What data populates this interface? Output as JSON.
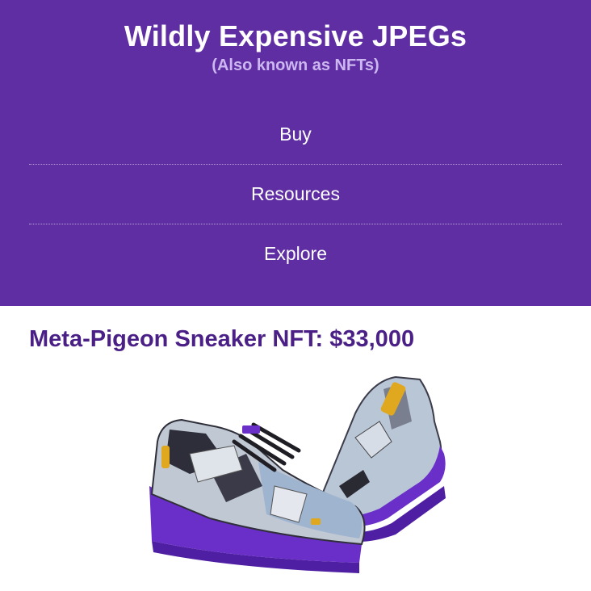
{
  "header": {
    "title": "Wildly Expensive JPEGs",
    "subtitle": "(Also known as NFTs)"
  },
  "nav": {
    "items": [
      {
        "label": "Buy"
      },
      {
        "label": "Resources"
      },
      {
        "label": "Explore"
      }
    ]
  },
  "product": {
    "title": "Meta-Pigeon Sneaker NFT: $33,000",
    "image_icon": "sneaker-image",
    "caption": ""
  },
  "colors": {
    "header_bg": "#5f2ea3",
    "title_text": "#ffffff",
    "subtitle_text": "#cdb7f0",
    "product_title": "#4a1f86",
    "sneaker_sole": "#6a2fc8"
  }
}
